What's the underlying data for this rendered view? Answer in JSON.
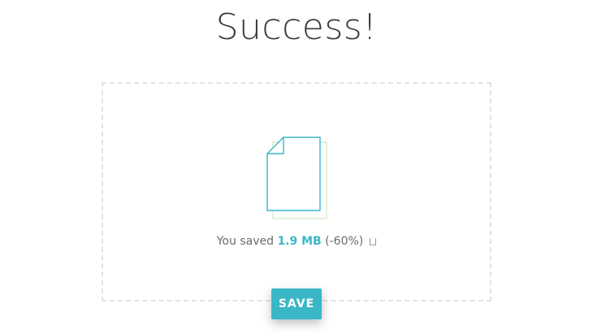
{
  "page": {
    "title": "Success!"
  },
  "result": {
    "prefix": "You saved ",
    "saved_amount": "1.9 MB",
    "percent": "(-60%)"
  },
  "actions": {
    "save_label": "SAVE"
  },
  "icons": {
    "file": "document-icon",
    "share": "share-icon"
  },
  "colors": {
    "accent": "#3ab7c6",
    "file_outline": "#3ab7c6",
    "file_shadow_outline": "#cfe8c2",
    "dashed_border": "#e3e3e3"
  }
}
